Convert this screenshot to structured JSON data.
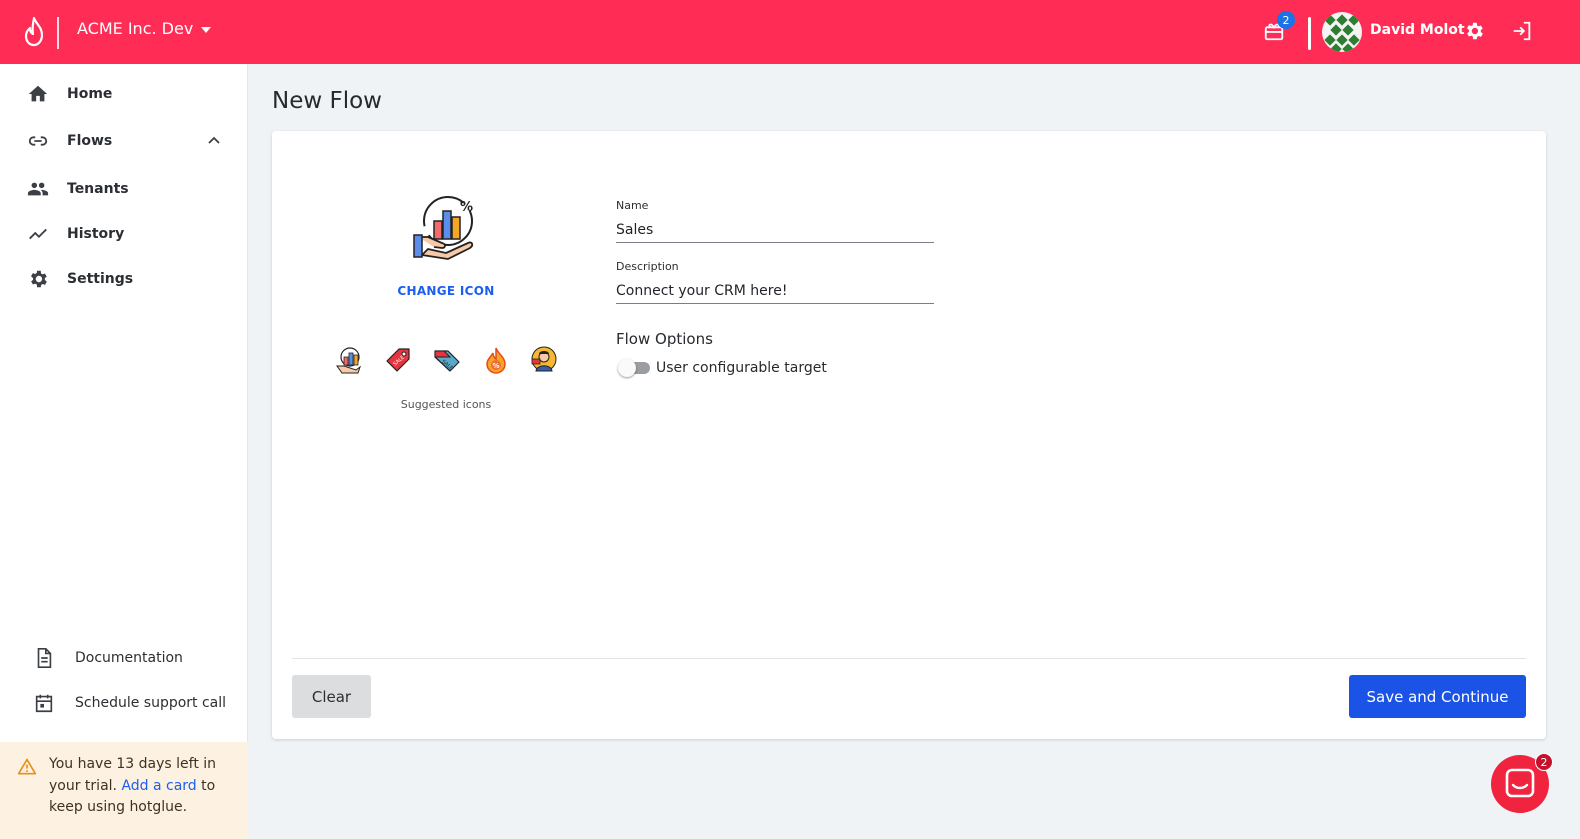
{
  "header": {
    "org_name": "ACME Inc. Dev",
    "notification_count": "2",
    "user_name": "David Molot"
  },
  "sidebar": {
    "items": [
      {
        "label": "Home",
        "icon": "home-icon"
      },
      {
        "label": "Flows",
        "icon": "link-icon"
      },
      {
        "label": "Tenants",
        "icon": "people-icon"
      },
      {
        "label": "History",
        "icon": "trend-icon"
      },
      {
        "label": "Settings",
        "icon": "gear-icon"
      }
    ],
    "footer_links": [
      {
        "label": "Documentation",
        "icon": "document-icon"
      },
      {
        "label": "Schedule support call",
        "icon": "calendar-icon"
      }
    ],
    "trial": {
      "text_before": "You have 13 days left in your trial.",
      "link": "Add a card",
      "text_after": "to keep using hotglue."
    }
  },
  "main": {
    "page_title": "New Flow",
    "change_icon_label": "CHANGE ICON",
    "suggested_caption": "Suggested icons",
    "suggested_icons": [
      "sales-chart-icon",
      "sale-tag-icon",
      "discount-tag-icon",
      "fire-percent-icon",
      "salesman-icon"
    ],
    "form": {
      "name_label": "Name",
      "name_value": "Sales",
      "description_label": "Description",
      "description_value": "Connect your CRM here!",
      "options_title": "Flow Options",
      "toggle_label": "User configurable target",
      "toggle_on": false
    },
    "buttons": {
      "clear": "Clear",
      "save": "Save and Continue"
    }
  },
  "chat": {
    "badge_count": "2"
  },
  "colors": {
    "brand": "#ff2d55",
    "primary": "#1a53e6",
    "link": "#1a5ff0",
    "trial_bg": "#fdf1e1"
  }
}
